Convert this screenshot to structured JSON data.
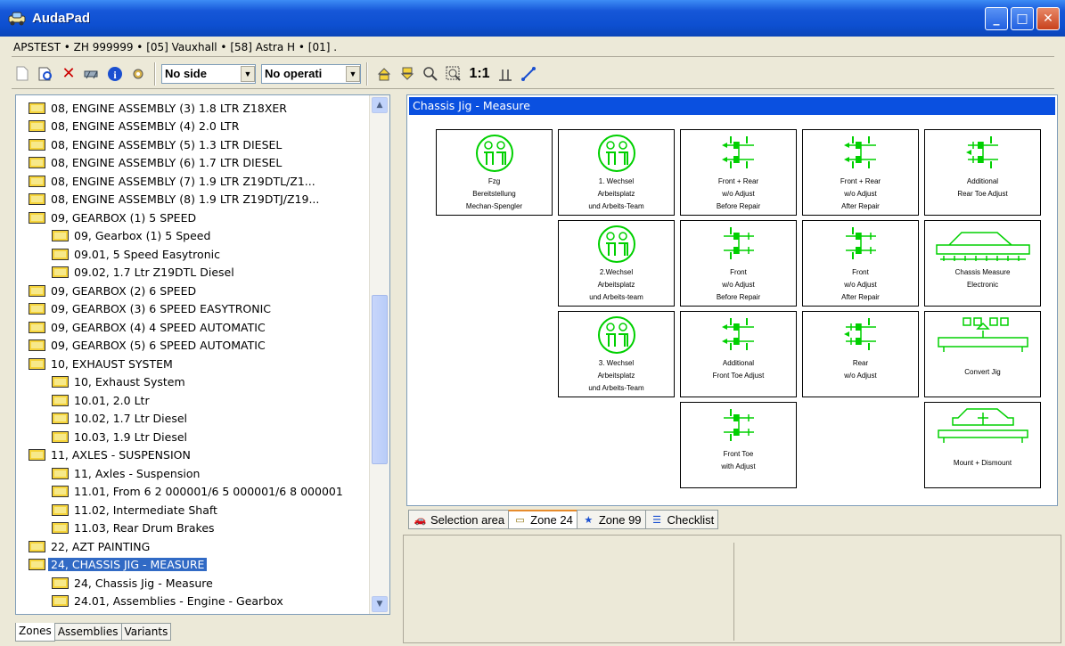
{
  "window": {
    "title": "AudaPad",
    "buttons": {
      "minimize": "_",
      "maximize": "□",
      "close": "✕"
    }
  },
  "breadcrumb": "APSTEST • ZH 999999 •  [05] Vauxhall • [58] Astra H • [01] .",
  "toolbar": {
    "side_select": "No side",
    "operation_select": "No operati",
    "scale_label": "1:1"
  },
  "tree": {
    "items": [
      {
        "label": "08, ENGINE ASSEMBLY (3) 1.8 LTR Z18XER",
        "level": 0
      },
      {
        "label": "08, ENGINE ASSEMBLY (4) 2.0 LTR",
        "level": 0
      },
      {
        "label": "08, ENGINE ASSEMBLY (5) 1.3 LTR DIESEL",
        "level": 0
      },
      {
        "label": "08, ENGINE ASSEMBLY (6) 1.7 LTR DIESEL",
        "level": 0
      },
      {
        "label": "08, ENGINE ASSEMBLY (7) 1.9 LTR Z19DTL/Z1...",
        "level": 0
      },
      {
        "label": "08, ENGINE ASSEMBLY (8) 1.9 LTR Z19DTJ/Z19...",
        "level": 0
      },
      {
        "label": "09, GEARBOX (1) 5 SPEED",
        "level": 0
      },
      {
        "label": "09, Gearbox (1) 5 Speed",
        "level": 1
      },
      {
        "label": "09.01, 5 Speed Easytronic",
        "level": 1
      },
      {
        "label": "09.02, 1.7 Ltr Z19DTL Diesel",
        "level": 1
      },
      {
        "label": "09, GEARBOX (2) 6 SPEED",
        "level": 0
      },
      {
        "label": "09, GEARBOX (3) 6 SPEED EASYTRONIC",
        "level": 0
      },
      {
        "label": "09, GEARBOX (4) 4 SPEED AUTOMATIC",
        "level": 0
      },
      {
        "label": "09, GEARBOX (5) 6 SPEED AUTOMATIC",
        "level": 0
      },
      {
        "label": "10, EXHAUST SYSTEM",
        "level": 0
      },
      {
        "label": "10, Exhaust System",
        "level": 1
      },
      {
        "label": "10.01, 2.0 Ltr",
        "level": 1
      },
      {
        "label": "10.02, 1.7 Ltr Diesel",
        "level": 1
      },
      {
        "label": "10.03, 1.9 Ltr Diesel",
        "level": 1
      },
      {
        "label": "11, AXLES - SUSPENSION",
        "level": 0
      },
      {
        "label": "11, Axles - Suspension",
        "level": 1
      },
      {
        "label": "11.01, From 6 2 000001/6 5 000001/6 8 000001",
        "level": 1
      },
      {
        "label": "11.02, Intermediate Shaft",
        "level": 1
      },
      {
        "label": "11.03, Rear Drum Brakes",
        "level": 1
      },
      {
        "label": "22, AZT PAINTING",
        "level": 0
      },
      {
        "label": "24, CHASSIS JIG - MEASURE",
        "level": 0,
        "selected": true
      },
      {
        "label": "24, Chassis Jig - Measure",
        "level": 1
      },
      {
        "label": "24.01, Assemblies - Engine - Gearbox",
        "level": 1
      }
    ]
  },
  "left_tabs": [
    "Zones",
    "Assemblies",
    "Variants"
  ],
  "canvas": {
    "title": "Chassis Jig - Measure",
    "tiles": [
      {
        "id": "t1",
        "icon": "workers",
        "lines": [
          "Fzg",
          "Bereitstellung",
          "Mechan-Spengler"
        ]
      },
      {
        "id": "t2",
        "icon": "workers",
        "lines": [
          "1. Wechsel",
          "Arbeitsplatz",
          "und Arbeits-Team"
        ]
      },
      {
        "id": "t3",
        "icon": "axle-full",
        "lines": [
          "Front + Rear",
          "w/o Adjust",
          "Before Repair"
        ]
      },
      {
        "id": "t4",
        "icon": "axle-full",
        "lines": [
          "Front + Rear",
          "w/o Adjust",
          "After Repair"
        ]
      },
      {
        "id": "t5",
        "icon": "axle-rear",
        "lines": [
          "Additional",
          "Rear Toe Adjust"
        ]
      },
      {
        "id": "t6",
        "icon": "workers",
        "lines": [
          "2.Wechsel",
          "Arbeitsplatz",
          "und Arbeits-team"
        ]
      },
      {
        "id": "t7",
        "icon": "axle-front",
        "lines": [
          "Front",
          "w/o Adjust",
          "Before Repair"
        ]
      },
      {
        "id": "t8",
        "icon": "axle-front",
        "lines": [
          "Front",
          "w/o Adjust",
          "After Repair"
        ]
      },
      {
        "id": "t9",
        "icon": "car",
        "lines": [
          "Chassis Measure",
          "Electronic"
        ]
      },
      {
        "id": "t10",
        "icon": "workers",
        "lines": [
          "3. Wechsel",
          "Arbeitsplatz",
          "und Arbeits-Team"
        ]
      },
      {
        "id": "t11",
        "icon": "axle-full",
        "lines": [
          "Additional",
          "Front Toe Adjust"
        ]
      },
      {
        "id": "t12",
        "icon": "axle-rear",
        "lines": [
          "Rear",
          "w/o Adjust"
        ]
      },
      {
        "id": "t13",
        "icon": "jig",
        "lines": [
          "Convert Jig"
        ]
      },
      {
        "id": "t14",
        "icon": "axle-front",
        "lines": [
          "Front Toe",
          "with Adjust"
        ]
      },
      {
        "id": "t15",
        "icon": "jig-car",
        "lines": [
          "Mount + Dismount"
        ]
      }
    ]
  },
  "right_tabs": [
    {
      "label": "Selection area",
      "icon": "car-icon",
      "active": false
    },
    {
      "label": "Zone 24",
      "icon": "zone-icon",
      "active": true
    },
    {
      "label": "Zone 99",
      "icon": "zone-star-icon",
      "active": false
    },
    {
      "label": "Checklist",
      "icon": "checklist-icon",
      "active": false
    }
  ],
  "colors": {
    "titlebar": "#0d4fd0",
    "canvas_header": "#0a50e0",
    "selection": "#316ac5",
    "icon_green": "#00d000"
  }
}
